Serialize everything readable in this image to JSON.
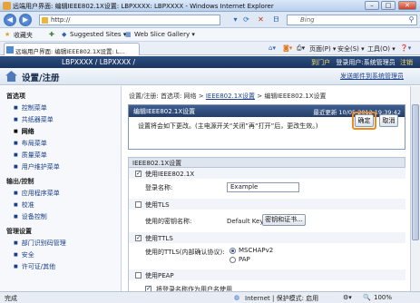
{
  "window": {
    "title": "远端用户界面: 编辑IEEE802.1X设置: LBPXXXX: LBPXXXX - Windows Internet Explorer",
    "minimize": "–",
    "maximize": "□",
    "close": "✕"
  },
  "browser": {
    "url": "http://",
    "search_placeholder": "Bing",
    "favorites_label": "收藏夹",
    "suggested_sites": "Suggested Sites ▾",
    "web_slice": "Web Slice Gallery ▾",
    "tab_title": "远端用户界面: 编辑IEEE802.1X设置: L...",
    "cmd_page": "页面(P) ▾",
    "cmd_safety": "安全(S) ▾",
    "cmd_tools": "工具(O) ▾",
    "cmd_help": "❓▾"
  },
  "app_header": {
    "product": "LBPXXXX / LBPXXXX /",
    "links_prefix": "到门户",
    "login_user": "登录用户:系统管理员",
    "logout": "注销",
    "portal_title": "设置/注册",
    "mail_link": "发送邮件到系统管理员"
  },
  "sidebar": {
    "sections": [
      {
        "title": "首选项",
        "items": [
          "控制菜单",
          "共纸器菜单",
          "网络",
          "布局菜单",
          "质量菜单",
          "用户维护菜单"
        ]
      },
      {
        "title": "输出/控制",
        "items": [
          "应用程序菜单",
          "校准",
          "设备控制"
        ]
      },
      {
        "title": "管理设置",
        "items": [
          "部门识别码管理",
          "安全",
          "许可证/其他"
        ]
      }
    ],
    "active_item": "网络"
  },
  "main": {
    "breadcrumb_prefix": "设置/注册: 首选项: 网络 >",
    "breadcrumb_link": "IEEE802.1X设置",
    "breadcrumb_suffix": "> 编辑IEEE802.1X设置",
    "edit_title": "编辑IEEE802.1X设置",
    "updated": "最近更新   10/05 2012 19:39:42",
    "message": "设置将会如下更改。(主电源开关“关闭”再“打开”后，更改生效。)",
    "ok_label": "确定",
    "cancel_label": "取消",
    "section_title": "IEEE802.1X设置",
    "use_ieee": "使用IEEE802.1X",
    "login_name_label": "登录名称:",
    "login_name_value": "Example",
    "use_tls": "使用TLS",
    "key_label": "使用的密钥名称:",
    "key_value": "Default Key",
    "key_cert_button": "密钥和证书...",
    "use_ttls": "使用TTLS",
    "ttls_protocol_label": "使用的TTLS(内部确认协议):",
    "protocol_mschap": "MSCHAPv2",
    "protocol_pap": "PAP",
    "use_peap": "使用PEAP",
    "use_login_as_user": "将登录名称作为用户名使用"
  },
  "status": {
    "left": "完成",
    "zone": "Internet | 保护模式: 启用",
    "zoom": "100%"
  }
}
